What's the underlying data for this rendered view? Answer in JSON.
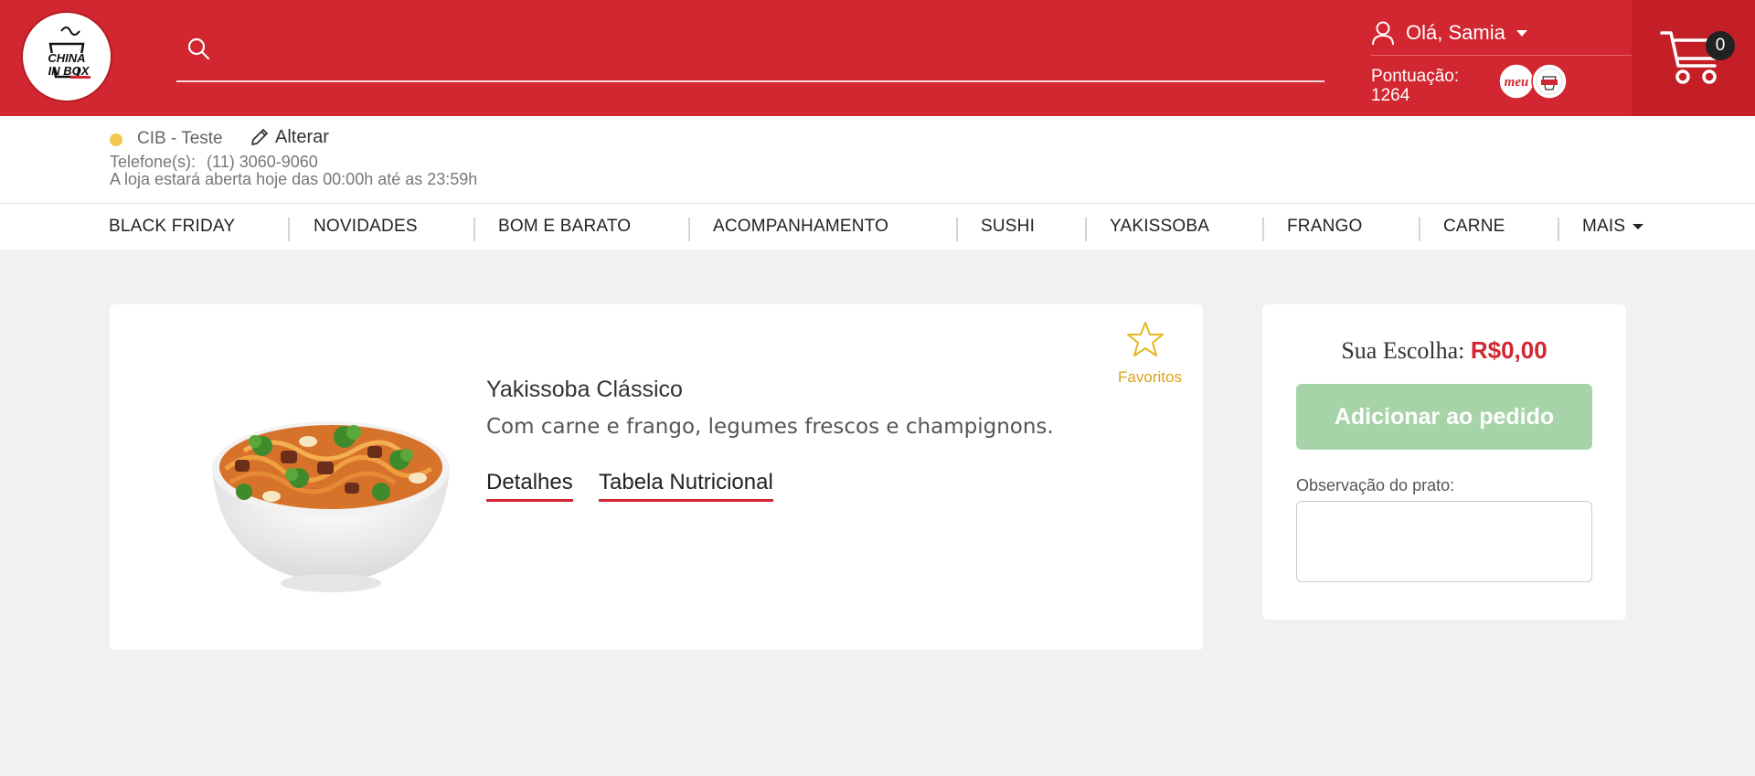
{
  "brand": {
    "logo_text_top": "CHINA",
    "logo_text_bottom": "IN BOX"
  },
  "colors": {
    "primary": "#d22630",
    "cart_bg": "#c41e27",
    "fav": "#d9a419",
    "add_button": "#a6d4a8",
    "status_dot": "#f2c84b"
  },
  "search": {
    "placeholder": "",
    "value": ""
  },
  "user": {
    "greeting": "Olá, Samia",
    "points_label": "Pontuação:",
    "points_value": "1264",
    "meu_badge_text": "meu"
  },
  "cart": {
    "count": "0"
  },
  "store": {
    "name": "CIB - Teste",
    "edit_label": "Alterar",
    "phone_label": "Telefone(s):",
    "phone": "(11) 3060-9060",
    "hours": "A loja estará aberta hoje das 00:00h até as 23:59h"
  },
  "nav": {
    "items": [
      "BLACK FRIDAY",
      "NOVIDADES",
      "BOM E BARATO",
      "ACOMPANHAMENTO",
      "SUSHI",
      "YAKISSOBA",
      "FRANGO",
      "CARNE",
      "MAIS"
    ]
  },
  "product": {
    "title": "Yakissoba Clássico",
    "description": "Com carne e frango, legumes frescos e champignons.",
    "favorite_label": "Favoritos",
    "details_label": "Detalhes",
    "nutrition_label": "Tabela Nutricional"
  },
  "order": {
    "choice_label": "Sua Escolha:",
    "choice_price": "R$0,00",
    "add_button": "Adicionar ao pedido",
    "note_label": "Observação do prato:",
    "note_value": ""
  },
  "icons": [
    "search-icon",
    "user-icon",
    "cart-icon",
    "pencil-icon",
    "star-icon",
    "caret-down-icon"
  ]
}
